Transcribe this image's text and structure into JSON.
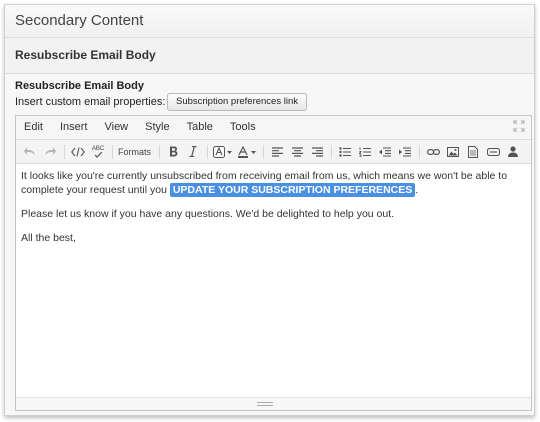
{
  "panel": {
    "title": "Secondary Content"
  },
  "section": {
    "title": "Resubscribe Email Body"
  },
  "field": {
    "label": "Resubscribe Email Body",
    "help": "Insert custom email properties:",
    "button_label": "Subscription preferences link"
  },
  "editor": {
    "menu": [
      "Edit",
      "Insert",
      "View",
      "Style",
      "Table",
      "Tools"
    ],
    "toolbar": {
      "formats_label": "Formats",
      "spellcheck_label": "ABC",
      "icons": [
        "undo-icon",
        "redo-icon",
        "source-code-icon",
        "spellcheck-icon",
        "formats-dropdown",
        "bold-icon",
        "italic-icon",
        "background-color-icon",
        "text-color-icon",
        "align-left-icon",
        "align-center-icon",
        "align-right-icon",
        "bullet-list-icon",
        "numbered-list-icon",
        "outdent-icon",
        "indent-icon",
        "link-icon",
        "image-icon",
        "document-icon",
        "media-icon",
        "person-icon"
      ]
    },
    "content": {
      "p1_before": "It looks like you're currently unsubscribed from receiving email from us, which means we won't be able to complete your request until you ",
      "p1_token": "UPDATE YOUR SUBSCRIPTION PREFERENCES",
      "p1_after": ".",
      "p2": "Please let us know if you have any questions. We'd be delighted to help you out.",
      "p3": "All the best,"
    },
    "colors": {
      "token_bg": "#4a90e2"
    }
  }
}
